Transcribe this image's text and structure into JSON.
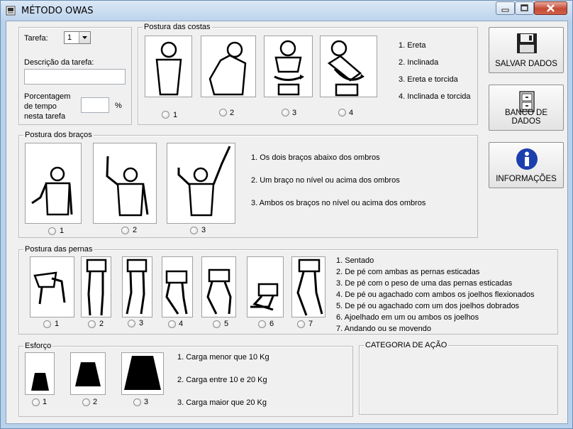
{
  "window": {
    "title": "MÉTODO OWAS"
  },
  "task": {
    "tarefa_label": "Tarefa:",
    "tarefa_value": "1",
    "descricao_label": "Descrição da tarefa:",
    "descricao_value": "",
    "porcentagem_line1": "Porcentagem",
    "porcentagem_line2": "de tempo",
    "porcentagem_line3": "nesta tarefa",
    "porcentagem_value": "",
    "percent_sign": "%"
  },
  "costas": {
    "title": "Postura das costas",
    "radios": [
      "1",
      "2",
      "3",
      "4"
    ],
    "items": [
      "1. Ereta",
      "2. Inclinada",
      "3. Ereta e torcida",
      "4. Inclinada e torcida"
    ]
  },
  "bracos": {
    "title": "Postura dos braços",
    "radios": [
      "1",
      "2",
      "3"
    ],
    "items": [
      "1. Os dois braços abaixo dos ombros",
      "2. Um braço no nível ou acima dos ombros",
      "3. Ambos os braços no nível ou acima dos ombros"
    ]
  },
  "pernas": {
    "title": "Postura das pernas",
    "radios": [
      "1",
      "2",
      "3",
      "4",
      "5",
      "6",
      "7"
    ],
    "items": [
      "1. Sentado",
      "2. De pé com ambas as pernas esticadas",
      "3. De pé com o peso de uma das pernas esticadas",
      "4. De pé ou agachado com ambos os joelhos flexionados",
      "5. De pé ou agachado com um dos joelhos dobrados",
      "6. Ajoelhado em um ou ambos os joelhos",
      "7. Andando ou se movendo"
    ]
  },
  "esforco": {
    "title": "Esforço",
    "radios": [
      "1",
      "2",
      "3"
    ],
    "items": [
      "1. Carga menor que 10 Kg",
      "2. Carga entre 10 e 20 Kg",
      "3. Carga maior que 20 Kg"
    ]
  },
  "categoria": {
    "title": "CATEGORIA DE AÇÃO"
  },
  "buttons": {
    "salvar": "SALVAR DADOS",
    "banco": "BANCO DE DADOS",
    "info": "INFORMAÇÕES"
  },
  "colors": {
    "accent": "#1c3fae",
    "close": "#c54a34"
  }
}
